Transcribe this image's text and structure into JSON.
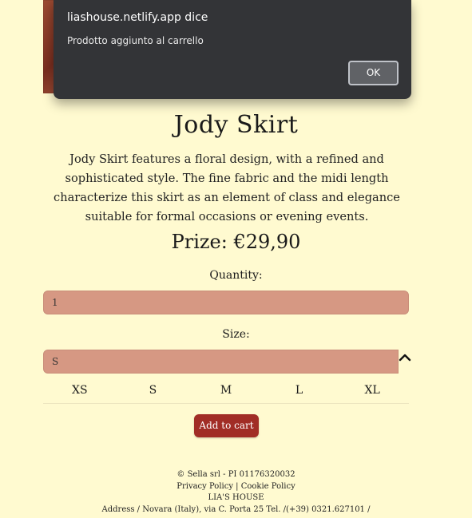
{
  "dialog": {
    "origin": "liashouse.netlify.app dice",
    "message": "Prodotto aggiunto al carrello",
    "ok_label": "OK"
  },
  "product": {
    "title": "Jody Skirt",
    "description": "Jody Skirt features a floral design, with a refined and sophisticated style. The fine fabric and the midi length characterize this skirt as an element of class and elegance suitable for formal occasions or evening events.",
    "prize": "Prize: €29,90"
  },
  "form": {
    "quantity_label": "Quantity:",
    "quantity_value": "1",
    "size_label": "Size:",
    "size_value": "S",
    "size_options": [
      "XS",
      "S",
      "M",
      "L",
      "XL"
    ],
    "add_to_cart_label": "Add to cart"
  },
  "footer": {
    "company": "© Sella srl - PI 01176320032",
    "privacy_policy": "Privacy Policy",
    "separator": " | ",
    "cookie_policy": "Cookie Policy",
    "brand": "LIA'S HOUSE",
    "address": "Address / Novara (Italy), via C. Porta 25 Tel. /(+39) 0321.627101 /"
  },
  "colors": {
    "page_background": "#fffad0",
    "input_background": "#d69883",
    "add_to_cart_background": "#a12d26",
    "dialog_background": "#333437"
  },
  "icons": {
    "size_toggle": "chevron-up-icon"
  }
}
